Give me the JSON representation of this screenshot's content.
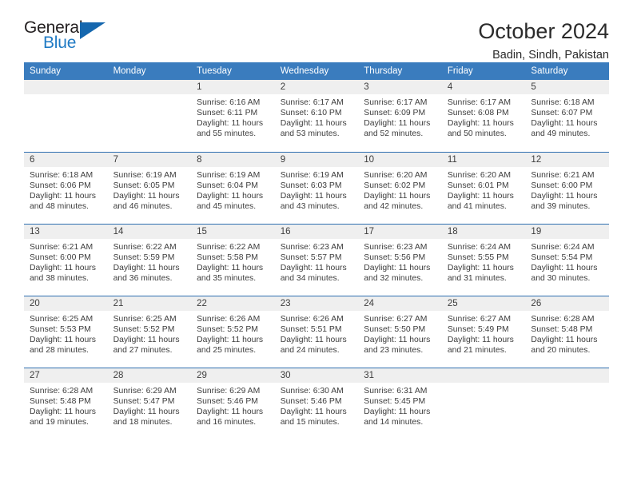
{
  "logo": {
    "line1": "General",
    "line2": "Blue",
    "triangle_color": "#1567ae",
    "blue_color": "#1f7ac4"
  },
  "header": {
    "title": "October 2024",
    "subtitle": "Badin, Sindh, Pakistan",
    "header_bg": "#3a7cbe",
    "row_rule_color": "#2f6fb0",
    "daynum_band_bg": "#efefef"
  },
  "weekdays": [
    "Sunday",
    "Monday",
    "Tuesday",
    "Wednesday",
    "Thursday",
    "Friday",
    "Saturday"
  ],
  "weeks": [
    [
      {
        "day": "",
        "empty": true
      },
      {
        "day": "",
        "empty": true
      },
      {
        "day": "1",
        "sunrise": "Sunrise: 6:16 AM",
        "sunset": "Sunset: 6:11 PM",
        "daylight": "Daylight: 11 hours and 55 minutes."
      },
      {
        "day": "2",
        "sunrise": "Sunrise: 6:17 AM",
        "sunset": "Sunset: 6:10 PM",
        "daylight": "Daylight: 11 hours and 53 minutes."
      },
      {
        "day": "3",
        "sunrise": "Sunrise: 6:17 AM",
        "sunset": "Sunset: 6:09 PM",
        "daylight": "Daylight: 11 hours and 52 minutes."
      },
      {
        "day": "4",
        "sunrise": "Sunrise: 6:17 AM",
        "sunset": "Sunset: 6:08 PM",
        "daylight": "Daylight: 11 hours and 50 minutes."
      },
      {
        "day": "5",
        "sunrise": "Sunrise: 6:18 AM",
        "sunset": "Sunset: 6:07 PM",
        "daylight": "Daylight: 11 hours and 49 minutes."
      }
    ],
    [
      {
        "day": "6",
        "sunrise": "Sunrise: 6:18 AM",
        "sunset": "Sunset: 6:06 PM",
        "daylight": "Daylight: 11 hours and 48 minutes."
      },
      {
        "day": "7",
        "sunrise": "Sunrise: 6:19 AM",
        "sunset": "Sunset: 6:05 PM",
        "daylight": "Daylight: 11 hours and 46 minutes."
      },
      {
        "day": "8",
        "sunrise": "Sunrise: 6:19 AM",
        "sunset": "Sunset: 6:04 PM",
        "daylight": "Daylight: 11 hours and 45 minutes."
      },
      {
        "day": "9",
        "sunrise": "Sunrise: 6:19 AM",
        "sunset": "Sunset: 6:03 PM",
        "daylight": "Daylight: 11 hours and 43 minutes."
      },
      {
        "day": "10",
        "sunrise": "Sunrise: 6:20 AM",
        "sunset": "Sunset: 6:02 PM",
        "daylight": "Daylight: 11 hours and 42 minutes."
      },
      {
        "day": "11",
        "sunrise": "Sunrise: 6:20 AM",
        "sunset": "Sunset: 6:01 PM",
        "daylight": "Daylight: 11 hours and 41 minutes."
      },
      {
        "day": "12",
        "sunrise": "Sunrise: 6:21 AM",
        "sunset": "Sunset: 6:00 PM",
        "daylight": "Daylight: 11 hours and 39 minutes."
      }
    ],
    [
      {
        "day": "13",
        "sunrise": "Sunrise: 6:21 AM",
        "sunset": "Sunset: 6:00 PM",
        "daylight": "Daylight: 11 hours and 38 minutes."
      },
      {
        "day": "14",
        "sunrise": "Sunrise: 6:22 AM",
        "sunset": "Sunset: 5:59 PM",
        "daylight": "Daylight: 11 hours and 36 minutes."
      },
      {
        "day": "15",
        "sunrise": "Sunrise: 6:22 AM",
        "sunset": "Sunset: 5:58 PM",
        "daylight": "Daylight: 11 hours and 35 minutes."
      },
      {
        "day": "16",
        "sunrise": "Sunrise: 6:23 AM",
        "sunset": "Sunset: 5:57 PM",
        "daylight": "Daylight: 11 hours and 34 minutes."
      },
      {
        "day": "17",
        "sunrise": "Sunrise: 6:23 AM",
        "sunset": "Sunset: 5:56 PM",
        "daylight": "Daylight: 11 hours and 32 minutes."
      },
      {
        "day": "18",
        "sunrise": "Sunrise: 6:24 AM",
        "sunset": "Sunset: 5:55 PM",
        "daylight": "Daylight: 11 hours and 31 minutes."
      },
      {
        "day": "19",
        "sunrise": "Sunrise: 6:24 AM",
        "sunset": "Sunset: 5:54 PM",
        "daylight": "Daylight: 11 hours and 30 minutes."
      }
    ],
    [
      {
        "day": "20",
        "sunrise": "Sunrise: 6:25 AM",
        "sunset": "Sunset: 5:53 PM",
        "daylight": "Daylight: 11 hours and 28 minutes."
      },
      {
        "day": "21",
        "sunrise": "Sunrise: 6:25 AM",
        "sunset": "Sunset: 5:52 PM",
        "daylight": "Daylight: 11 hours and 27 minutes."
      },
      {
        "day": "22",
        "sunrise": "Sunrise: 6:26 AM",
        "sunset": "Sunset: 5:52 PM",
        "daylight": "Daylight: 11 hours and 25 minutes."
      },
      {
        "day": "23",
        "sunrise": "Sunrise: 6:26 AM",
        "sunset": "Sunset: 5:51 PM",
        "daylight": "Daylight: 11 hours and 24 minutes."
      },
      {
        "day": "24",
        "sunrise": "Sunrise: 6:27 AM",
        "sunset": "Sunset: 5:50 PM",
        "daylight": "Daylight: 11 hours and 23 minutes."
      },
      {
        "day": "25",
        "sunrise": "Sunrise: 6:27 AM",
        "sunset": "Sunset: 5:49 PM",
        "daylight": "Daylight: 11 hours and 21 minutes."
      },
      {
        "day": "26",
        "sunrise": "Sunrise: 6:28 AM",
        "sunset": "Sunset: 5:48 PM",
        "daylight": "Daylight: 11 hours and 20 minutes."
      }
    ],
    [
      {
        "day": "27",
        "sunrise": "Sunrise: 6:28 AM",
        "sunset": "Sunset: 5:48 PM",
        "daylight": "Daylight: 11 hours and 19 minutes."
      },
      {
        "day": "28",
        "sunrise": "Sunrise: 6:29 AM",
        "sunset": "Sunset: 5:47 PM",
        "daylight": "Daylight: 11 hours and 18 minutes."
      },
      {
        "day": "29",
        "sunrise": "Sunrise: 6:29 AM",
        "sunset": "Sunset: 5:46 PM",
        "daylight": "Daylight: 11 hours and 16 minutes."
      },
      {
        "day": "30",
        "sunrise": "Sunrise: 6:30 AM",
        "sunset": "Sunset: 5:46 PM",
        "daylight": "Daylight: 11 hours and 15 minutes."
      },
      {
        "day": "31",
        "sunrise": "Sunrise: 6:31 AM",
        "sunset": "Sunset: 5:45 PM",
        "daylight": "Daylight: 11 hours and 14 minutes."
      },
      {
        "day": "",
        "empty": true
      },
      {
        "day": "",
        "empty": true
      }
    ]
  ]
}
